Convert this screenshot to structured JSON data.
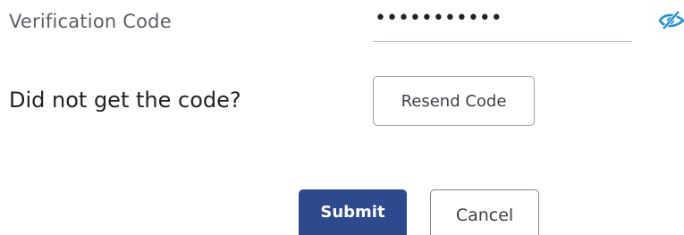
{
  "verification": {
    "label": "Verification Code",
    "masked_value": "•••••••••••"
  },
  "resend": {
    "prompt": "Did not get the code?",
    "button_label": "Resend Code"
  },
  "actions": {
    "submit_label": "Submit",
    "cancel_label": "Cancel"
  },
  "icons": {
    "visibility_toggle": "eye-slash-icon"
  },
  "colors": {
    "primary": "#2e4a8e",
    "icon_accent": "#1e8fd6",
    "label_muted": "#5a5f66"
  }
}
